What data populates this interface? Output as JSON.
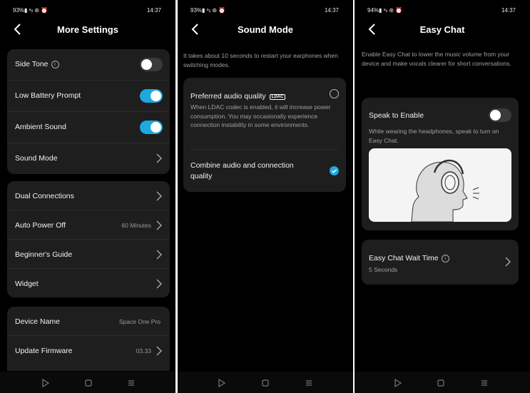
{
  "screens": {
    "more_settings": {
      "status": {
        "left": "93%▮ ᵃᵢₗ ⊛ ⏰",
        "time": "14:37"
      },
      "title": "More Settings",
      "group1": [
        {
          "label": "Side Tone",
          "toggle": false
        },
        {
          "label": "Low Battery Prompt",
          "toggle": true
        },
        {
          "label": "Ambient Sound",
          "toggle": true
        },
        {
          "label": "Sound Mode"
        }
      ],
      "group2": [
        {
          "label": "Dual Connections"
        },
        {
          "label": "Auto Power Off",
          "value": "60 Minutes"
        },
        {
          "label": "Beginner's Guide"
        },
        {
          "label": "Widget"
        }
      ],
      "group3": [
        {
          "label": "Device Name",
          "value": "Space One Pro"
        },
        {
          "label": "Update Firmware",
          "value": "03.33"
        }
      ]
    },
    "sound_mode": {
      "status": {
        "left": "93%▮ ᵃᵢₗ ⊛ ⏰",
        "time": "14:37"
      },
      "title": "Sound Mode",
      "intro": "It takes about 10 seconds to restart your earphones when switching modes.",
      "option1_title": "Preferred audio quality",
      "option1_badge": "LDAC",
      "option1_desc": "When LDAC codec is enabled, it will increase power consumption. You may occasionally experience connection instability in some environments.",
      "option2_title": "Combine audio and connection quality",
      "selected": "option2"
    },
    "easy_chat": {
      "status": {
        "left": "94%▮ ᵃᵢₗ ⊛ ⏰",
        "time": "14:37"
      },
      "title": "Easy Chat",
      "intro": "Enable Easy Chat to lower the music volume from your device and make vocals clearer for short conversations.",
      "speak_label": "Speak to Enable",
      "speak_toggle": false,
      "speak_desc": "While wearing the headphones, speak to turn on Easy Chat.",
      "wait_label": "Easy Chat Wait Time",
      "wait_value": "5 Seconds"
    }
  },
  "colors": {
    "accent": "#1fa8e0",
    "card": "#1e1e1e",
    "background": "#000000"
  }
}
